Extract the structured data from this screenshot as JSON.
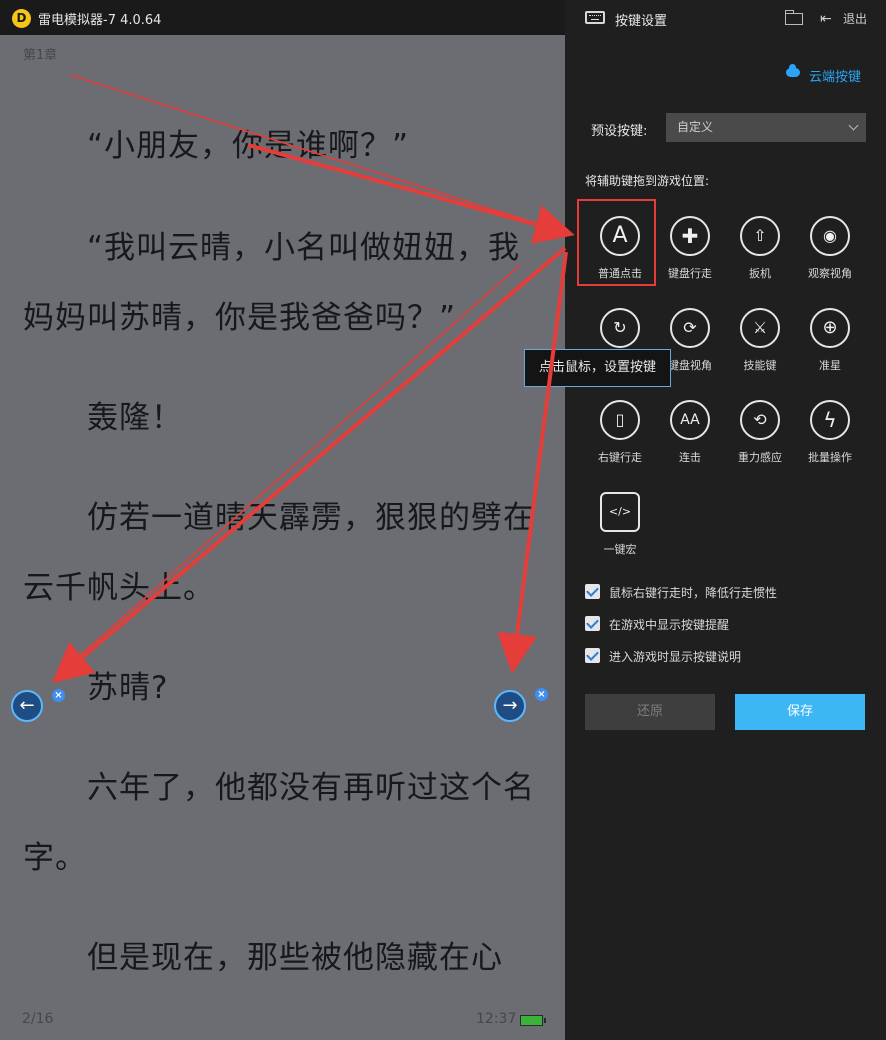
{
  "titlebar": {
    "app_title": "雷电模拟器-7 4.0.64",
    "logo_glyph": "D"
  },
  "reader": {
    "chapter": "第1章",
    "paragraphs": [
      "　　“小朋友，你是谁啊？”",
      "　　“我叫云晴，小名叫做妞妞，我妈妈叫苏晴，你是我爸爸吗？”",
      "　　轰隆！",
      "　　仿若一道晴天霹雳，狠狠的劈在云千帆头上。",
      "　　苏晴?",
      "　　六年了，他都没有再听过这个名字。",
      "　　但是现在，那些被他隐藏在心"
    ],
    "page_number": "2/16",
    "clock": "12:37",
    "prev_glyph": "←",
    "next_glyph": "→",
    "close_glyph": "×"
  },
  "panel": {
    "title": "按键设置",
    "exit_label": "退出",
    "exit_glyph": "⇤",
    "cloud_label": "云端按键",
    "preset_label": "预设按键:",
    "preset_value": "自定义",
    "drag_label": "将辅助键拖到游戏位置:",
    "keys": [
      {
        "label": "普通点击",
        "glyph": "A",
        "icon": "tap-a-icon"
      },
      {
        "label": "键盘行走",
        "glyph": "✚",
        "icon": "dpad-icon"
      },
      {
        "label": "扳机",
        "glyph": "⇧",
        "icon": "trigger-icon"
      },
      {
        "label": "观察视角",
        "glyph": "◉",
        "icon": "eye-icon"
      },
      {
        "label": "",
        "glyph": "↻",
        "icon": "rotate-view-icon"
      },
      {
        "label": "键盘视角",
        "glyph": "⟳",
        "icon": "keyboard-view-icon"
      },
      {
        "label": "技能键",
        "glyph": "⚔",
        "icon": "skill-icon"
      },
      {
        "label": "准星",
        "glyph": "⊕",
        "icon": "crosshair-icon"
      },
      {
        "label": "右键行走",
        "glyph": "▯",
        "icon": "mouse-icon"
      },
      {
        "label": "连击",
        "glyph": "AA",
        "icon": "combo-icon"
      },
      {
        "label": "重力感应",
        "glyph": "⟲",
        "icon": "gravity-icon"
      },
      {
        "label": "批量操作",
        "glyph": "ϟ",
        "icon": "bolt-icon"
      },
      {
        "label": "一键宏",
        "glyph": "</>",
        "icon": "macro-icon"
      }
    ],
    "tooltip": "点击鼠标，设置按键",
    "checkboxes": [
      "鼠标右键行走时，降低行走惯性",
      "在游戏中显示按键提醒",
      "进入游戏时显示按键说明"
    ],
    "restore_label": "还原",
    "save_label": "保存"
  },
  "colors": {
    "accent": "#3cb7f4",
    "annotation": "#e53d3a",
    "link": "#2aa5f5"
  }
}
